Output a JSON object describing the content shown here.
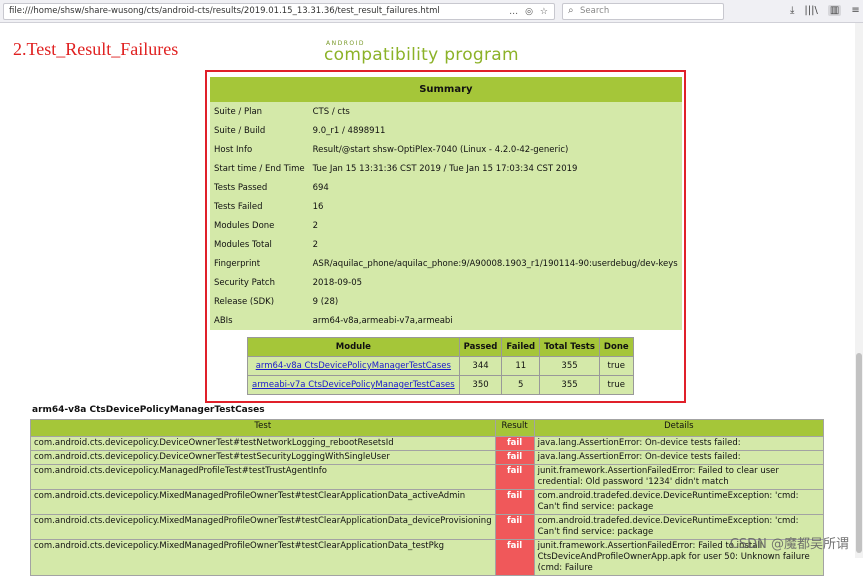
{
  "browser": {
    "url": "file:///home/shsw/share-wusong/cts/android-cts/results/2019.01.15_13.31.36/test_result_failures.html",
    "url_icons": [
      "…",
      "◎",
      "☆"
    ],
    "search_placeholder": "Search",
    "right_icons": [
      "⤓",
      "|||\\",
      "▥",
      "≡"
    ]
  },
  "heading": "2.Test_Result_Failures",
  "logo": {
    "small": "ANDROID",
    "big": "compatibility program"
  },
  "summary": {
    "header": "Summary",
    "rows": [
      {
        "k": "Suite / Plan",
        "v": "CTS / cts"
      },
      {
        "k": "Suite / Build",
        "v": "9.0_r1 / 4898911"
      },
      {
        "k": "Host Info",
        "v": "Result/@start shsw-OptiPlex-7040 (Linux - 4.2.0-42-generic)"
      },
      {
        "k": "Start time / End Time",
        "v": "Tue Jan 15 13:31:36 CST 2019 / Tue Jan 15 17:03:34 CST 2019"
      },
      {
        "k": "Tests Passed",
        "v": "694"
      },
      {
        "k": "Tests Failed",
        "v": "16"
      },
      {
        "k": "Modules Done",
        "v": "2"
      },
      {
        "k": "Modules Total",
        "v": "2"
      },
      {
        "k": "Fingerprint",
        "v": "ASR/aquilac_phone/aquilac_phone:9/A90008.1903_r1/190114-90:userdebug/dev-keys"
      },
      {
        "k": "Security Patch",
        "v": "2018-09-05"
      },
      {
        "k": "Release (SDK)",
        "v": "9 (28)"
      },
      {
        "k": "ABIs",
        "v": "arm64-v8a,armeabi-v7a,armeabi"
      }
    ]
  },
  "modules": {
    "headers": [
      "Module",
      "Passed",
      "Failed",
      "Total Tests",
      "Done"
    ],
    "rows": [
      {
        "module": "arm64-v8a CtsDevicePolicyManagerTestCases",
        "passed": "344",
        "failed": "11",
        "total": "355",
        "done": "true"
      },
      {
        "module": "armeabi-v7a CtsDevicePolicyManagerTestCases",
        "passed": "350",
        "failed": "5",
        "total": "355",
        "done": "true"
      }
    ]
  },
  "section_title": "arm64-v8a CtsDevicePolicyManagerTestCases",
  "details": {
    "headers": [
      "Test",
      "Result",
      "Details"
    ],
    "rows": [
      {
        "test": "com.android.cts.devicepolicy.DeviceOwnerTest#testNetworkLogging_rebootResetsId",
        "result": "fail",
        "details": "java.lang.AssertionError: On-device tests failed:"
      },
      {
        "test": "com.android.cts.devicepolicy.DeviceOwnerTest#testSecurityLoggingWithSingleUser",
        "result": "fail",
        "details": "java.lang.AssertionError: On-device tests failed:"
      },
      {
        "test": "com.android.cts.devicepolicy.ManagedProfileTest#testTrustAgentInfo",
        "result": "fail",
        "details": "junit.framework.AssertionFailedError: Failed to clear user credential: Old password '1234' didn't match"
      },
      {
        "test": "com.android.cts.devicepolicy.MixedManagedProfileOwnerTest#testClearApplicationData_activeAdmin",
        "result": "fail",
        "details": "com.android.tradefed.device.DeviceRuntimeException: 'cmd: Can't find service: package"
      },
      {
        "test": "com.android.cts.devicepolicy.MixedManagedProfileOwnerTest#testClearApplicationData_deviceProvisioning",
        "result": "fail",
        "details": "com.android.tradefed.device.DeviceRuntimeException: 'cmd: Can't find service: package"
      },
      {
        "test": "com.android.cts.devicepolicy.MixedManagedProfileOwnerTest#testClearApplicationData_testPkg",
        "result": "fail",
        "details": "junit.framework.AssertionFailedError: Failed to install CtsDeviceAndProfileOwnerApp.apk for user 50: Unknown failure (cmd: Failure"
      }
    ]
  },
  "watermark": "CSDN @魔都吴所谓"
}
